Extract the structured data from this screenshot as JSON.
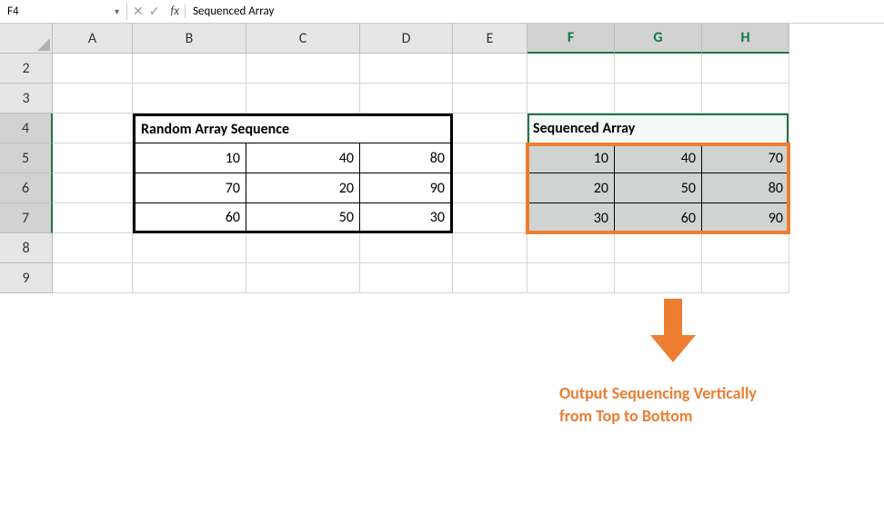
{
  "nameBox": "F4",
  "formula": "Sequenced Array",
  "columns": [
    "A",
    "B",
    "C",
    "D",
    "E",
    "F",
    "G",
    "H"
  ],
  "rows": [
    "2",
    "3",
    "4",
    "5",
    "6",
    "7",
    "8",
    "9"
  ],
  "selectedCols": [
    "F",
    "G",
    "H"
  ],
  "selectedRows": [
    "4",
    "5",
    "6",
    "7"
  ],
  "table1": {
    "title": "Random Array Sequence",
    "data": [
      [
        10,
        40,
        80
      ],
      [
        70,
        20,
        90
      ],
      [
        60,
        50,
        30
      ]
    ]
  },
  "table2": {
    "title": "Sequenced Array",
    "data": [
      [
        10,
        40,
        70
      ],
      [
        20,
        50,
        80
      ],
      [
        30,
        60,
        90
      ]
    ]
  },
  "annotation": {
    "line1": "Output Sequencing Vertically",
    "line2": "from Top to Bottom"
  }
}
